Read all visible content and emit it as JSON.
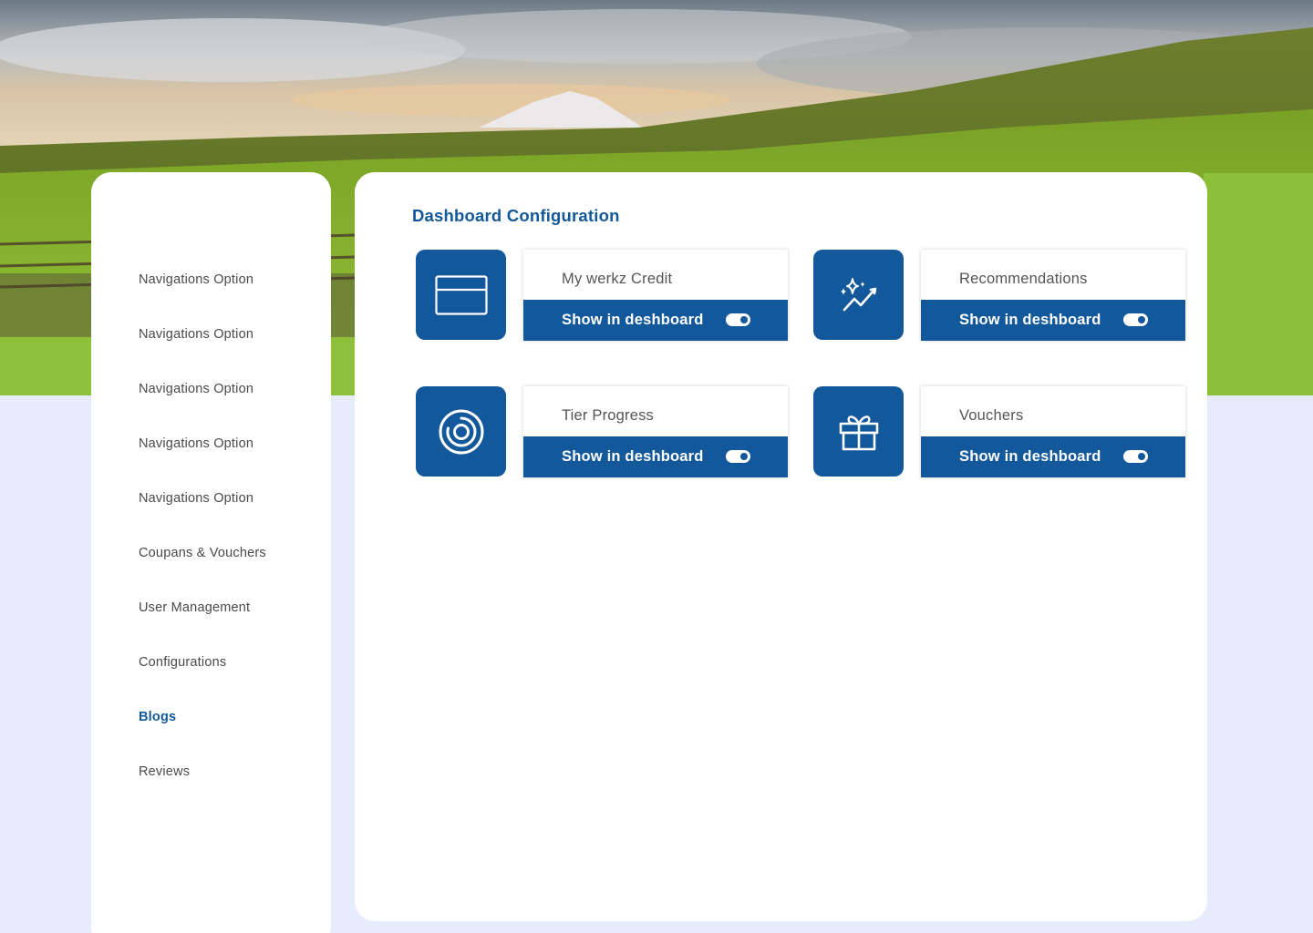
{
  "colors": {
    "accent": "#13589a",
    "page_background": "#e7ecfd",
    "panel_background": "#ffffff",
    "nav_text": "#4a4a4a",
    "card_title_text": "#555555"
  },
  "sidebar": {
    "items": [
      {
        "label": "Navigations Option",
        "active": false
      },
      {
        "label": "Navigations Option",
        "active": false
      },
      {
        "label": "Navigations Option",
        "active": false
      },
      {
        "label": "Navigations Option",
        "active": false
      },
      {
        "label": "Navigations Option",
        "active": false
      },
      {
        "label": "Coupans & Vouchers",
        "active": false
      },
      {
        "label": "User Management",
        "active": false
      },
      {
        "label": "Configurations",
        "active": false
      },
      {
        "label": "Blogs",
        "active": true
      },
      {
        "label": "Reviews",
        "active": false
      }
    ]
  },
  "main": {
    "title": "Dashboard Configuration",
    "widgets": [
      {
        "title": "My werkz Credit",
        "toggle_label": "Show in deshboard",
        "enabled": true,
        "icon": "credit-card-icon"
      },
      {
        "title": "Recommendations",
        "toggle_label": "Show in deshboard",
        "enabled": true,
        "icon": "sparkle-trend-icon"
      },
      {
        "title": "Tier Progress",
        "toggle_label": "Show in deshboard",
        "enabled": true,
        "icon": "progress-rings-icon"
      },
      {
        "title": "Vouchers",
        "toggle_label": "Show in deshboard",
        "enabled": true,
        "icon": "gift-icon"
      }
    ]
  }
}
